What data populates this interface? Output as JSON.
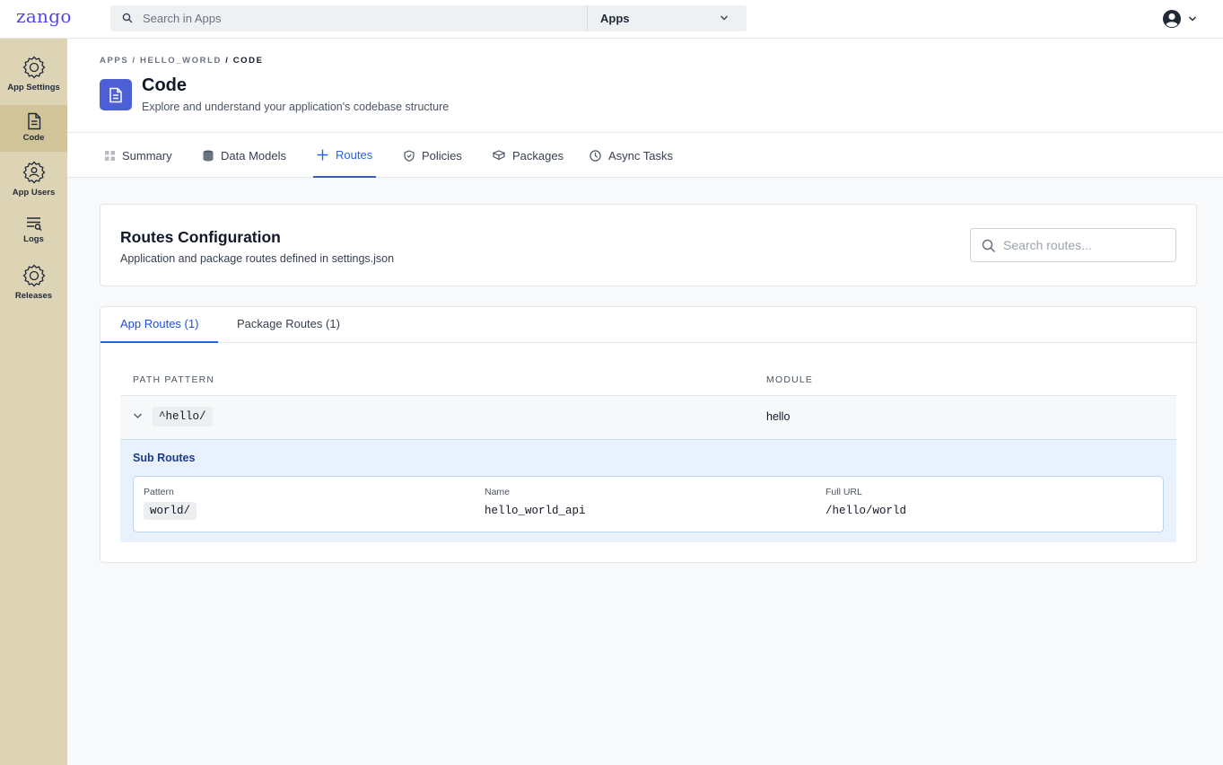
{
  "app": {
    "logo": "zango"
  },
  "topbar": {
    "search_placeholder": "Search in Apps",
    "scope_label": "Apps"
  },
  "sidebar": {
    "items": [
      {
        "label": "App Settings",
        "icon": "gear-icon",
        "active": false
      },
      {
        "label": "Code",
        "icon": "document-icon",
        "active": true
      },
      {
        "label": "App Users",
        "icon": "users-gear-icon",
        "active": false
      },
      {
        "label": "Logs",
        "icon": "logs-icon",
        "active": false
      },
      {
        "label": "Releases",
        "icon": "gear-icon",
        "active": false
      }
    ]
  },
  "header": {
    "breadcrumb": [
      "APPS",
      "HELLO_WORLD",
      "CODE"
    ],
    "breadcrumb_sep": " / ",
    "title": "Code",
    "subtitle": "Explore and understand your application's codebase structure"
  },
  "tabs": [
    {
      "label": "Summary",
      "icon": "grid-icon",
      "active": false
    },
    {
      "label": "Data Models",
      "icon": "database-icon",
      "active": false
    },
    {
      "label": "Routes",
      "icon": "plus-icon",
      "active": true
    },
    {
      "label": "Policies",
      "icon": "shield-icon",
      "active": false
    },
    {
      "label": "Packages",
      "icon": "package-icon",
      "active": false
    },
    {
      "label": "Async Tasks",
      "icon": "clock-icon",
      "active": false
    }
  ],
  "config": {
    "title": "Routes Configuration",
    "subtitle": "Application and package routes defined in settings.json",
    "search_placeholder": "Search routes..."
  },
  "routes": {
    "tabs": [
      {
        "label": "App Routes (1)",
        "active": true
      },
      {
        "label": "Package Routes (1)",
        "active": false
      }
    ],
    "columns": {
      "path": "PATH PATTERN",
      "module": "MODULE"
    },
    "rows": [
      {
        "pattern": "^hello/",
        "module": "hello",
        "expanded": true
      }
    ],
    "sub_routes": {
      "title": "Sub Routes",
      "labels": {
        "pattern": "Pattern",
        "name": "Name",
        "full_url": "Full URL"
      },
      "items": [
        {
          "pattern": "world/",
          "name": "hello_world_api",
          "full_url": "/hello/world"
        }
      ]
    }
  },
  "colors": {
    "brand": "#4f46e5",
    "accent": "#2563eb",
    "sidebar": "#ddd4b5",
    "sidebar_active": "#d1c499"
  }
}
